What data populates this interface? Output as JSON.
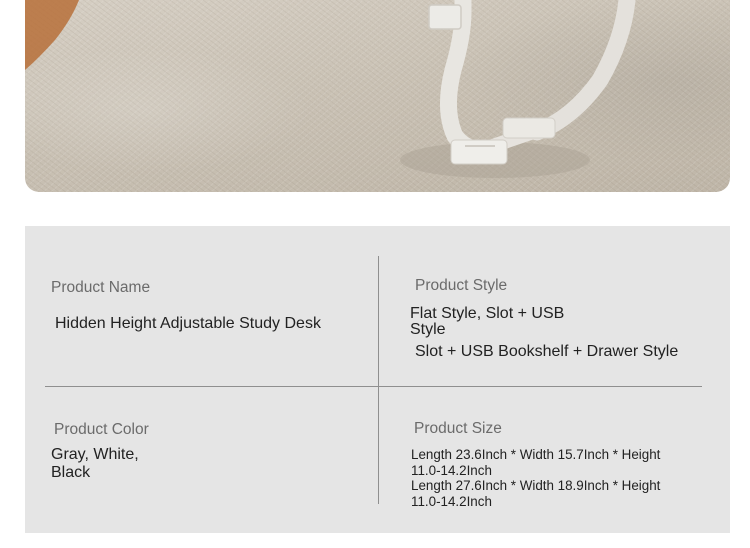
{
  "product_photo": {
    "description_icon": "desk-leg-on-carpet-photo"
  },
  "specs": {
    "product_name": {
      "label": "Product Name",
      "value": "Hidden Height Adjustable Study Desk"
    },
    "product_style": {
      "label": "Product Style",
      "values": [
        "Flat Style, Slot + USB Style",
        "Slot + USB Bookshelf + Drawer Style"
      ]
    },
    "product_color": {
      "label": "Product Color",
      "value": "Gray, White, Black"
    },
    "product_size": {
      "label": "Product Size",
      "values": [
        "Length 23.6Inch * Width 15.7Inch * Height 11.0-14.2Inch",
        "Length 27.6Inch * Width 18.9Inch * Height 11.0-14.2Inch"
      ]
    }
  },
  "colors": {
    "panel_background": "#e5e5e5",
    "divider": "#8f8f8f",
    "label_text": "#6b6b6b",
    "value_text": "#222222"
  }
}
